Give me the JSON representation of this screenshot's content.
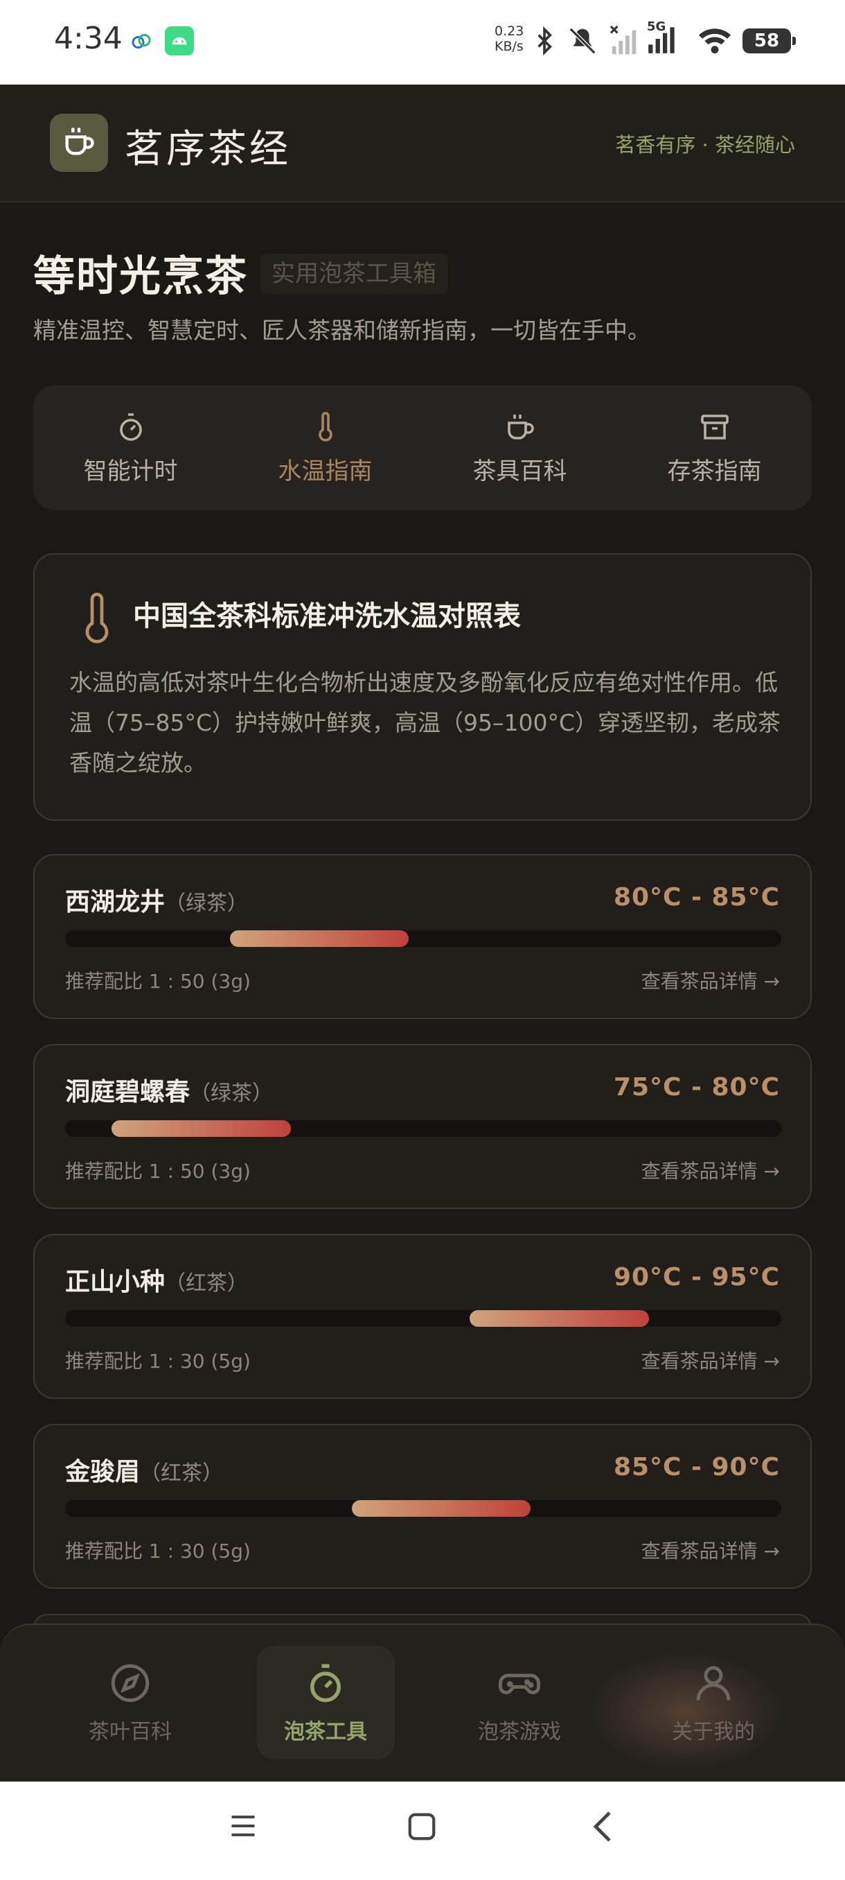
{
  "status_bar": {
    "time": "4:34",
    "speed_value": "0.23",
    "speed_unit": "KB/s",
    "network": "5G",
    "battery": "58"
  },
  "header": {
    "brand": "茗序茶经",
    "slogan": "茗香有序 · 茶经随心"
  },
  "hero": {
    "title": "等时光烹茶",
    "tag": "实用泡茶工具箱",
    "subtitle": "精准温控、智慧定时、匠人茶器和储新指南，一切皆在手中。"
  },
  "tabs": [
    {
      "label": "智能计时",
      "icon": "timer-icon",
      "active": false
    },
    {
      "label": "水温指南",
      "icon": "thermometer-icon",
      "active": true
    },
    {
      "label": "茶具百科",
      "icon": "cup-icon",
      "active": false
    },
    {
      "label": "存茶指南",
      "icon": "archive-box-icon",
      "active": false
    }
  ],
  "intro": {
    "title": "中国全茶科标准冲洗水温对照表",
    "body": "水温的高低对茶叶生化合物析出速度及多酚氧化反应有绝对性作用。低温（75–85°C）护持嫩叶鲜爽，高温（95–100°C）穿透坚韧，老成茶香随之绽放。"
  },
  "teas": [
    {
      "name": "西湖龙井",
      "category": "（绿茶）",
      "temp": "80°C  -  85°C",
      "ratio": "推荐配比 1 : 50 (3g)",
      "detail": "查看茶品详情 →",
      "range_start": 0.23,
      "range_end": 0.48
    },
    {
      "name": "洞庭碧螺春",
      "category": "（绿茶）",
      "temp": "75°C  -  80°C",
      "ratio": "推荐配比 1 : 50 (3g)",
      "detail": "查看茶品详情 →",
      "range_start": 0.065,
      "range_end": 0.315
    },
    {
      "name": "正山小种",
      "category": "（红茶）",
      "temp": "90°C  -  95°C",
      "ratio": "推荐配比 1 : 30 (5g)",
      "detail": "查看茶品详情 →",
      "range_start": 0.565,
      "range_end": 0.815
    },
    {
      "name": "金骏眉",
      "category": "（红茶）",
      "temp": "85°C  -  90°C",
      "ratio": "推荐配比 1 : 30 (5g)",
      "detail": "查看茶品详情 →",
      "range_start": 0.4,
      "range_end": 0.65
    }
  ],
  "bottom_nav": [
    {
      "label": "茶叶百科",
      "icon": "compass-icon",
      "active": false
    },
    {
      "label": "泡茶工具",
      "icon": "stopwatch-icon",
      "active": true
    },
    {
      "label": "泡茶游戏",
      "icon": "gamepad-icon",
      "active": false
    },
    {
      "label": "关于我的",
      "icon": "user-icon",
      "active": false
    }
  ],
  "colors": {
    "background": "#1b1915",
    "accent_green": "#93a56a",
    "accent_copper": "#b8916a",
    "bar_gradient_start": "#cfa37c",
    "bar_gradient_end": "#c0413c"
  }
}
